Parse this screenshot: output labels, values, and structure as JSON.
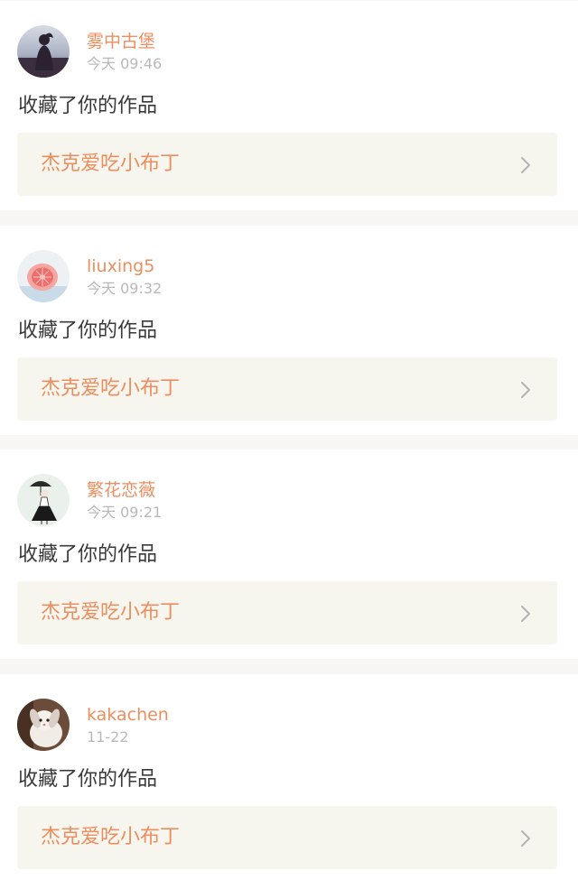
{
  "notifications": [
    {
      "username": "雾中古堡",
      "time": "今天 09:46",
      "action": "收藏了你的作品",
      "work_title": "杰克爱吃小布丁",
      "avatar_icon": "user-avatar-silhouette"
    },
    {
      "username": "liuxing5",
      "time": "今天 09:32",
      "action": "收藏了你的作品",
      "work_title": "杰克爱吃小布丁",
      "avatar_icon": "user-avatar-grapefruit"
    },
    {
      "username": "繁花恋薇",
      "time": "今天 09:21",
      "action": "收藏了你的作品",
      "work_title": "杰克爱吃小布丁",
      "avatar_icon": "user-avatar-girl-umbrella"
    },
    {
      "username": "kakachen",
      "time": "11-22",
      "action": "收藏了你的作品",
      "work_title": "杰克爱吃小布丁",
      "avatar_icon": "user-avatar-bunny"
    }
  ],
  "colors": {
    "accent": "#ec8e5f",
    "timestamp": "#b9b9b9",
    "body_text": "#3a3a3a",
    "link_bg": "#f6f6ee",
    "page_bg": "#f7f6f5"
  }
}
